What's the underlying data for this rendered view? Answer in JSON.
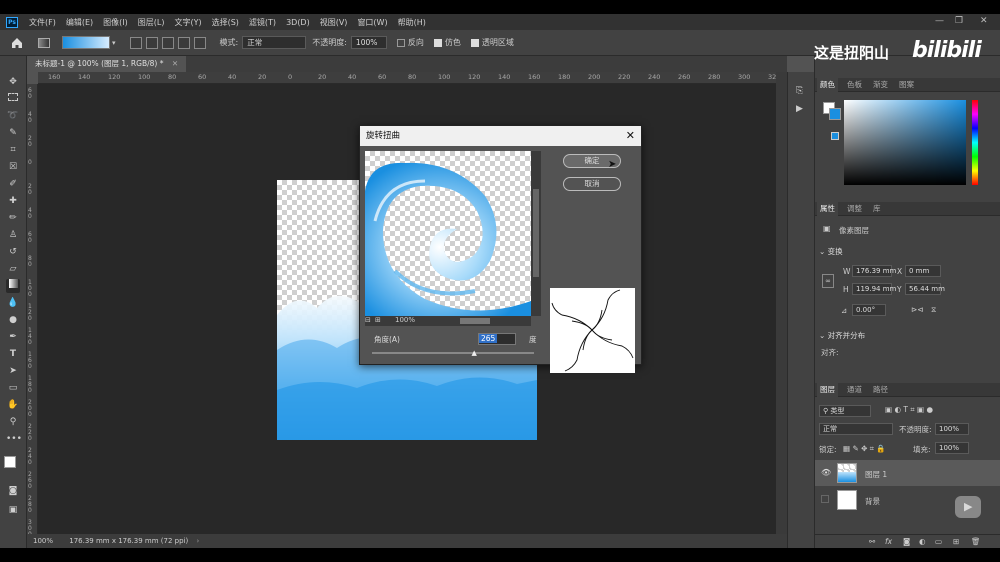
{
  "app": {
    "logo": "Ps",
    "menu": [
      "文件(F)",
      "编辑(E)",
      "图像(I)",
      "图层(L)",
      "文字(Y)",
      "选择(S)",
      "滤镜(T)",
      "3D(D)",
      "视图(V)",
      "窗口(W)",
      "帮助(H)"
    ],
    "window_controls": [
      "—",
      "❐",
      "✕"
    ]
  },
  "options_bar": {
    "mode_label": "模式:",
    "mode_value": "正常",
    "opacity_label": "不透明度:",
    "opacity_value": "100%",
    "reverse_label": "反向",
    "dither_label": "仿色",
    "transparency_label": "透明区域"
  },
  "document": {
    "tab_title": "未标题-1 @ 100% (图层 1, RGB/8) *",
    "status_zoom": "100%",
    "status_size": "176.39 mm x 176.39 mm (72 ppi)"
  },
  "rulers": {
    "top": [
      "160",
      "140",
      "120",
      "100",
      "80",
      "60",
      "40",
      "20",
      "0",
      "20",
      "40",
      "60",
      "80",
      "100",
      "120",
      "140",
      "160",
      "180",
      "200",
      "220",
      "240",
      "260",
      "280",
      "300",
      "320"
    ],
    "left": [
      "60",
      "40",
      "20",
      "0",
      "20",
      "40",
      "60",
      "80",
      "100",
      "120",
      "140",
      "160",
      "180",
      "200",
      "220",
      "240",
      "260",
      "280",
      "300"
    ]
  },
  "dialog": {
    "title": "旋转扭曲",
    "ok_label": "确定",
    "cancel_label": "取消",
    "zoom_value": "100%",
    "angle_label": "角度(A)",
    "angle_value": "265",
    "angle_unit": "度",
    "angle_min": -999,
    "angle_max": 999
  },
  "watermark": {
    "text": "这是扭阳山",
    "logo": "bilibili"
  },
  "color_panel": {
    "tabs": [
      "颜色",
      "色板",
      "渐变",
      "图案"
    ],
    "hue_color": "#1a8fe0",
    "foreground": "#ffffff",
    "background": "#1a8fe0"
  },
  "properties_panel": {
    "tabs": [
      "属性",
      "调整",
      "库"
    ],
    "layer_kind": "像素图层",
    "transform_title": "变换",
    "w_label": "W",
    "w_value": "176.39 mm",
    "x_label": "X",
    "x_value": "0 mm",
    "h_label": "H",
    "h_value": "119.94 mm",
    "y_label": "Y",
    "y_value": "56.44 mm",
    "angle_value": "0.00°",
    "align_title": "对齐并分布",
    "align_label": "对齐:"
  },
  "layers_panel": {
    "tabs": [
      "图层",
      "通道",
      "路径"
    ],
    "filter_label": "类型",
    "blend_mode": "正常",
    "opacity_label": "不透明度:",
    "opacity_value": "100%",
    "lock_label": "锁定:",
    "fill_label": "填充:",
    "fill_value": "100%",
    "layers": [
      {
        "name": "图层 1",
        "visible": true,
        "selected": true
      },
      {
        "name": "背景",
        "visible": false,
        "selected": false
      }
    ],
    "footer_icons": [
      "link-icon",
      "fx-icon",
      "mask-icon",
      "adjustment-icon",
      "group-icon",
      "new-layer-icon",
      "trash-icon"
    ]
  }
}
